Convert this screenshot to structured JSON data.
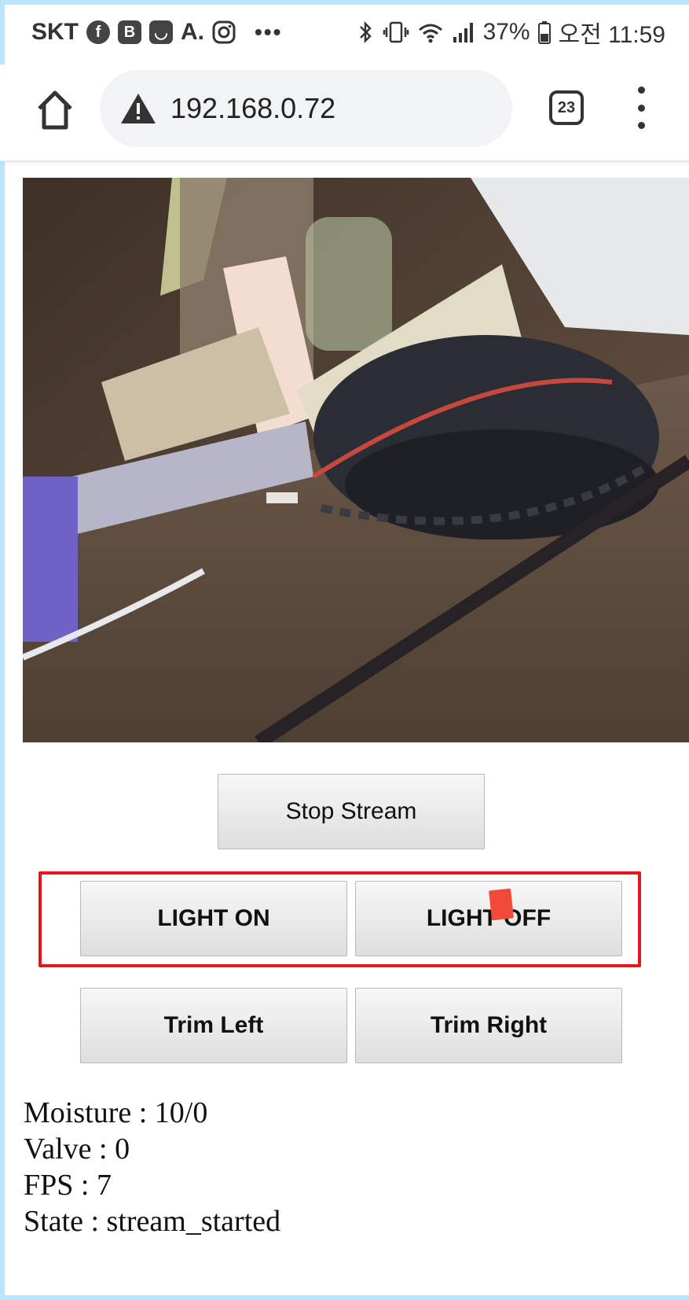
{
  "status_bar": {
    "carrier": "SKT",
    "notification_icons": [
      "facebook-icon",
      "b-app-icon",
      "shopping-bag-icon",
      "a-app-icon",
      "instagram-icon"
    ],
    "b_letter": "B",
    "a_letter": "A.",
    "more": "•••",
    "battery_percent": "37%",
    "time": "오전 11:59"
  },
  "browser": {
    "url": "192.168.0.72",
    "tab_count": "23"
  },
  "controls": {
    "stop_stream": "Stop Stream",
    "light_on": "LIGHT ON",
    "light_off": "LIGHT OFF",
    "trim_left": "Trim Left",
    "trim_right": "Trim Right"
  },
  "info": {
    "moisture": "Moisture : 10/0",
    "valve": "Valve : 0",
    "fps": "FPS : 7",
    "state": "State : stream_started"
  },
  "colors": {
    "highlight_border": "#e8141b",
    "frame_border": "#b9e6ff",
    "cursor_marker": "#f24a3a"
  }
}
